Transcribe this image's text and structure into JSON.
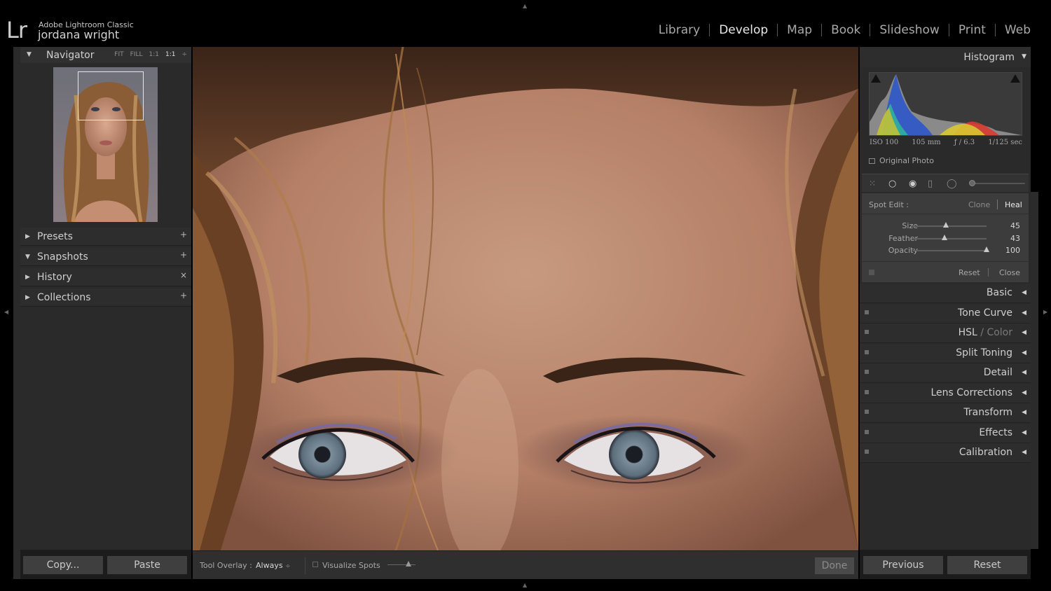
{
  "app": {
    "product": "Adobe Lightroom Classic",
    "logo": "Lr",
    "user": "jordana wright"
  },
  "modules": [
    {
      "label": "Library",
      "active": false
    },
    {
      "label": "Develop",
      "active": true
    },
    {
      "label": "Map",
      "active": false
    },
    {
      "label": "Book",
      "active": false
    },
    {
      "label": "Slideshow",
      "active": false
    },
    {
      "label": "Print",
      "active": false
    },
    {
      "label": "Web",
      "active": false
    }
  ],
  "left_panel": {
    "navigator": {
      "title": "Navigator",
      "zoom": [
        "FIT",
        "FILL",
        "1:1",
        "1:1"
      ],
      "zoom_active": "1:1"
    },
    "sections": [
      {
        "label": "Presets",
        "action": "+",
        "expanded": false
      },
      {
        "label": "Snapshots",
        "action": "+",
        "expanded": true
      },
      {
        "label": "History",
        "action": "×",
        "expanded": false
      },
      {
        "label": "Collections",
        "action": "+",
        "expanded": false
      }
    ],
    "footer": {
      "copy": "Copy...",
      "paste": "Paste"
    }
  },
  "toolbar": {
    "tool_overlay_label": "Tool Overlay :",
    "tool_overlay_value": "Always",
    "visualize_spots": "Visualize Spots",
    "done": "Done"
  },
  "right_panel": {
    "histogram": {
      "title": "Histogram",
      "exif": {
        "iso": "ISO 100",
        "focal": "105 mm",
        "aperture": "ƒ / 6.3",
        "shutter": "1/125 sec"
      },
      "original_photo": "Original Photo"
    },
    "spot_edit": {
      "title": "Spot Edit :",
      "clone": "Clone",
      "heal": "Heal",
      "active_mode": "Heal",
      "sliders": [
        {
          "label": "Size",
          "value": "45",
          "fraction": 0.45
        },
        {
          "label": "Feather",
          "value": "43",
          "fraction": 0.43
        },
        {
          "label": "Opacity",
          "value": "100",
          "fraction": 1.0
        }
      ],
      "reset": "Reset",
      "close": "Close"
    },
    "panels": [
      {
        "label": "Basic",
        "has_switch": false
      },
      {
        "label": "Tone Curve",
        "has_switch": true
      },
      {
        "label": "HSL",
        "label_dim": " / Color",
        "has_switch": true
      },
      {
        "label": "Split Toning",
        "has_switch": true
      },
      {
        "label": "Detail",
        "has_switch": true
      },
      {
        "label": "Lens Corrections",
        "has_switch": true
      },
      {
        "label": "Transform",
        "has_switch": true
      },
      {
        "label": "Effects",
        "has_switch": true
      },
      {
        "label": "Calibration",
        "has_switch": true
      }
    ],
    "footer": {
      "previous": "Previous",
      "reset": "Reset"
    }
  },
  "colors": {
    "panel_bg": "#2a2a2a",
    "header_bg": "#2d2d2d",
    "text": "#cfcfcf",
    "active_text": "#e8e8e8"
  }
}
